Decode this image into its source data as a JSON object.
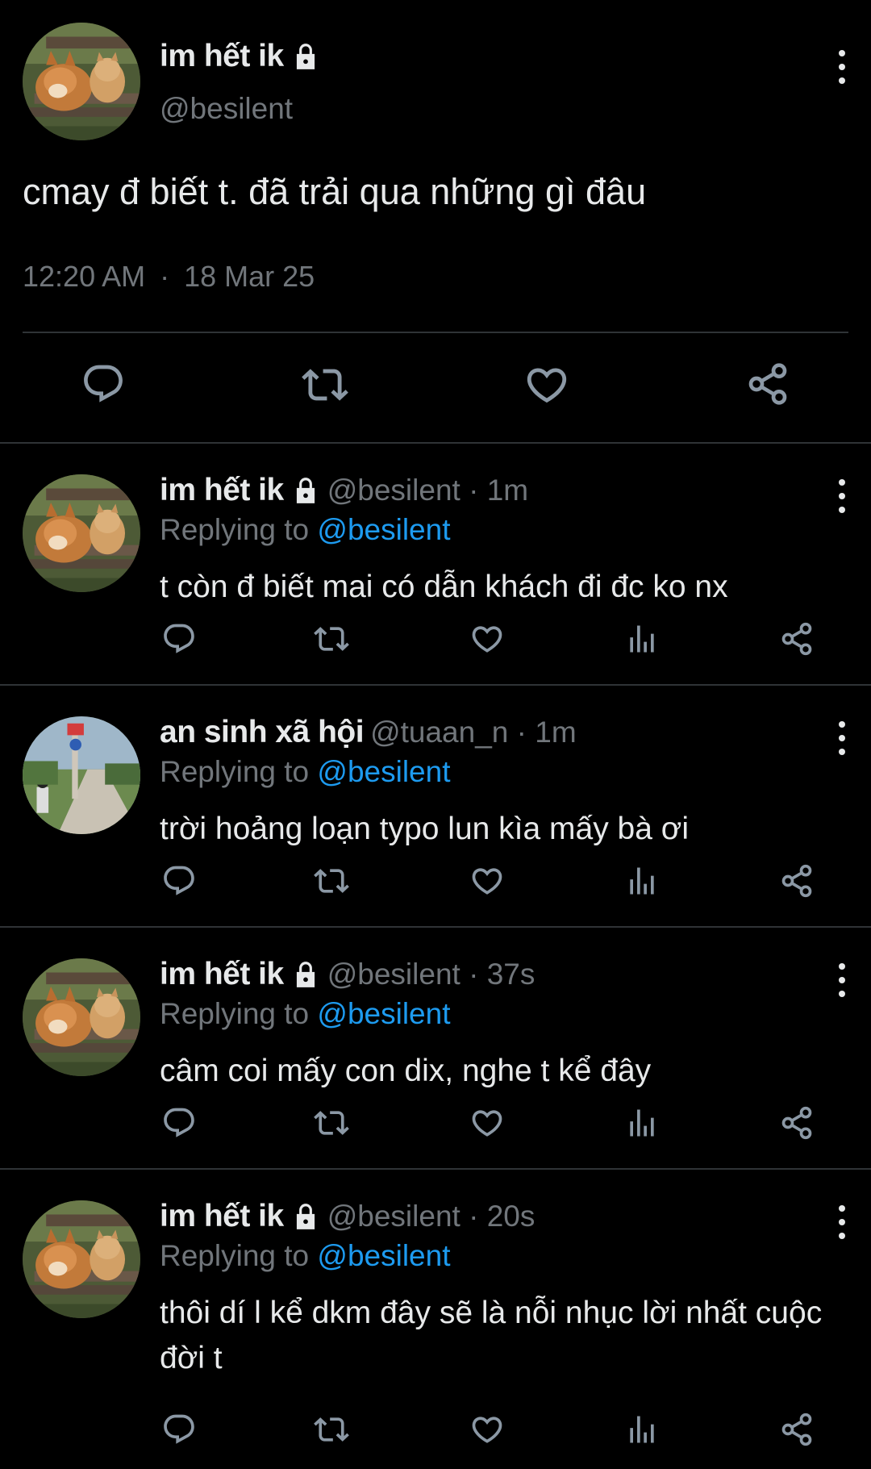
{
  "main_tweet": {
    "name": "im hết ik",
    "handle": "@besilent",
    "text": "cmay đ biết t. đã trải qua những gì đâu",
    "time": "12:20 AM",
    "separator": "·",
    "date": "18 Mar 25"
  },
  "replies": [
    {
      "name": "im hết ik",
      "handle_time": "@besilent · 1m",
      "replying_prefix": "Replying to ",
      "replying_to": "@besilent",
      "text": "t còn đ biết mai có dẫn khách đi đc ko nx",
      "locked": true,
      "avatar": "shiba-cat-bench"
    },
    {
      "name": "an sinh xã hội",
      "handle_time": "@tuaan_n · 1m",
      "replying_prefix": "Replying to ",
      "replying_to": "@besilent",
      "text": "trời hoảng loạn typo lun kìa mấy bà ơi",
      "locked": false,
      "avatar": "street-photo"
    },
    {
      "name": "im hết ik",
      "handle_time": "@besilent · 37s",
      "replying_prefix": "Replying to ",
      "replying_to": "@besilent",
      "text": "câm coi mấy con dix, nghe t kể đây",
      "locked": true,
      "avatar": "shiba-cat-bench"
    },
    {
      "name": "im hết ik",
      "handle_time": "@besilent · 20s",
      "replying_prefix": "Replying to ",
      "replying_to": "@besilent",
      "text": "thôi dí l kể dkm đây sẽ là nỗi nhục lời nhất cuộc đời t",
      "locked": true,
      "avatar": "shiba-cat-bench"
    }
  ],
  "icons": {
    "reply": "reply-icon",
    "retweet": "retweet-icon",
    "like": "heart-icon",
    "views": "views-icon",
    "share": "share-icon",
    "more": "more-vertical-icon",
    "lock": "lock-icon"
  },
  "colors": {
    "background": "#000000",
    "text": "#e7e9ea",
    "muted": "#71767b",
    "mention": "#1d9bf0",
    "divider": "#2f3336"
  }
}
